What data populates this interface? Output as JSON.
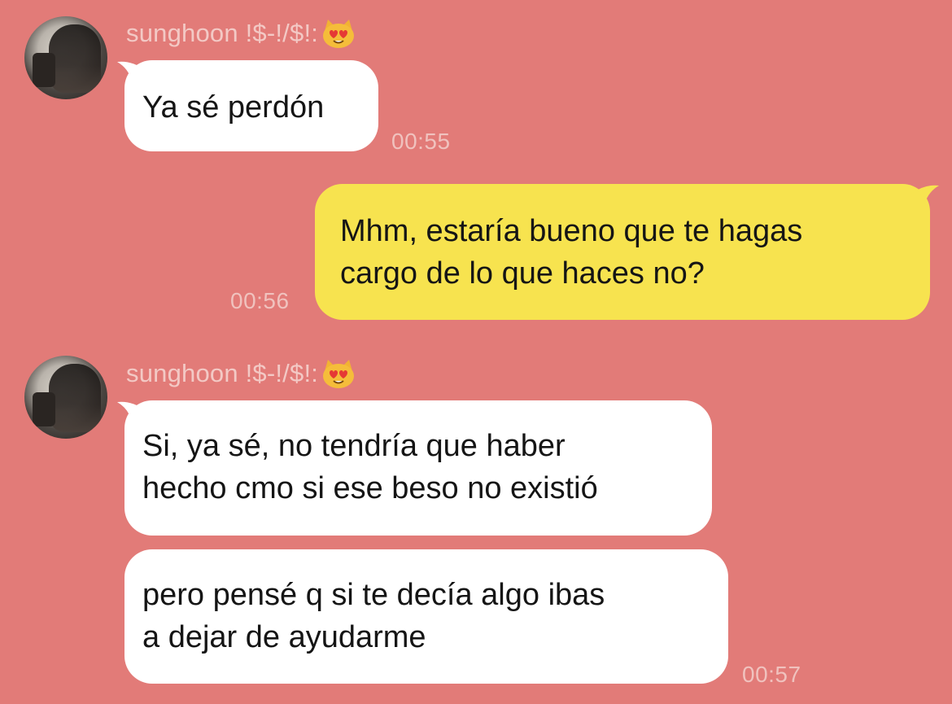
{
  "colors": {
    "background": "#e27b78",
    "incoming_bubble": "#ffffff",
    "outgoing_bubble": "#f7e34f",
    "meta_text": "#f0c2be"
  },
  "messages": [
    {
      "sender": "sunghoon !$-!/$!:",
      "sender_emoji": "heart-eyes-cat-emoji",
      "lines": [
        "Ya sé perdón"
      ],
      "time": "00:55"
    },
    {
      "sender": "",
      "lines": [
        "Mhm, estaría bueno que te hagas",
        "cargo de lo que haces no?"
      ],
      "time": "00:56"
    },
    {
      "sender": "sunghoon !$-!/$!:",
      "sender_emoji": "heart-eyes-cat-emoji",
      "lines": [
        "Si, ya sé, no tendría que haber",
        "hecho cmo si ese beso no existió"
      ],
      "time": ""
    },
    {
      "sender": "",
      "lines": [
        "pero pensé q si te decía algo ibas",
        "a dejar de ayudarme"
      ],
      "time": "00:57"
    }
  ]
}
